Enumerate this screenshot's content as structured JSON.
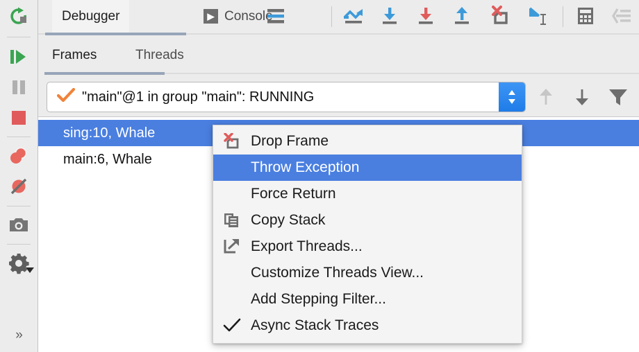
{
  "sidebar": {
    "buttons": [
      {
        "name": "rerun-icon",
        "title": "Rerun"
      },
      {
        "name": "resume-program-icon",
        "title": "Resume Program"
      },
      {
        "name": "pause-program-icon",
        "title": "Pause Program"
      },
      {
        "name": "stop-icon",
        "title": "Stop"
      },
      {
        "name": "view-breakpoints-icon",
        "title": "View Breakpoints"
      },
      {
        "name": "mute-breakpoints-icon",
        "title": "Mute Breakpoints"
      },
      {
        "name": "camera-icon",
        "title": "Get Thread Dump"
      },
      {
        "name": "settings-gear-icon",
        "title": "Settings"
      }
    ],
    "more_label": "»"
  },
  "topbar": {
    "tabs": [
      {
        "label": "Debugger",
        "active": true
      },
      {
        "label": "Console",
        "active": false
      }
    ],
    "icons": [
      {
        "name": "layout-settings-icon",
        "title": "Layout Settings"
      },
      {
        "name": "step-over-icon",
        "title": "Step Over"
      },
      {
        "name": "step-into-icon",
        "title": "Step Into"
      },
      {
        "name": "force-step-into-icon",
        "title": "Force Step Into"
      },
      {
        "name": "step-out-icon",
        "title": "Step Out"
      },
      {
        "name": "drop-frame-icon",
        "title": "Drop Frame"
      },
      {
        "name": "run-to-cursor-icon",
        "title": "Run to Cursor"
      },
      {
        "name": "evaluate-expression-icon",
        "title": "Evaluate Expression"
      },
      {
        "name": "show-execution-point-icon",
        "title": "Show Execution Point"
      }
    ]
  },
  "subtabs": {
    "tabs": [
      {
        "label": "Frames",
        "active": true
      },
      {
        "label": "Threads",
        "active": false
      }
    ]
  },
  "thread_selector": {
    "value": "\"main\"@1 in group \"main\": RUNNING",
    "check_color": "#f0833a",
    "stepper_color": "#2f86ef",
    "actions": [
      {
        "name": "move-up-icon",
        "title": "Move Up",
        "enabled": false
      },
      {
        "name": "move-down-icon",
        "title": "Move Down",
        "enabled": true
      },
      {
        "name": "filter-icon",
        "title": "Filter",
        "enabled": true
      }
    ]
  },
  "frames": {
    "selection_color": "#4a7fe0",
    "items": [
      {
        "label": "sing:10, Whale",
        "selected": true
      },
      {
        "label": "main:6, Whale",
        "selected": false
      }
    ]
  },
  "context_menu": {
    "highlight_color": "#4a7fe0",
    "items": [
      {
        "label": "Drop Frame",
        "icon": "drop-frame-icon",
        "selected": false,
        "checked": false
      },
      {
        "label": "Throw Exception",
        "icon": "none",
        "selected": true,
        "checked": false
      },
      {
        "label": "Force Return",
        "icon": "none",
        "selected": false,
        "checked": false
      },
      {
        "label": "Copy Stack",
        "icon": "copy-stack-icon",
        "selected": false,
        "checked": false
      },
      {
        "label": "Export Threads...",
        "icon": "export-threads-icon",
        "selected": false,
        "checked": false
      },
      {
        "label": "Customize Threads View...",
        "icon": "none",
        "selected": false,
        "checked": false
      },
      {
        "label": "Add Stepping Filter...",
        "icon": "none",
        "selected": false,
        "checked": false
      },
      {
        "label": "Async Stack Traces",
        "icon": "checkmark-icon",
        "selected": false,
        "checked": true
      }
    ]
  }
}
